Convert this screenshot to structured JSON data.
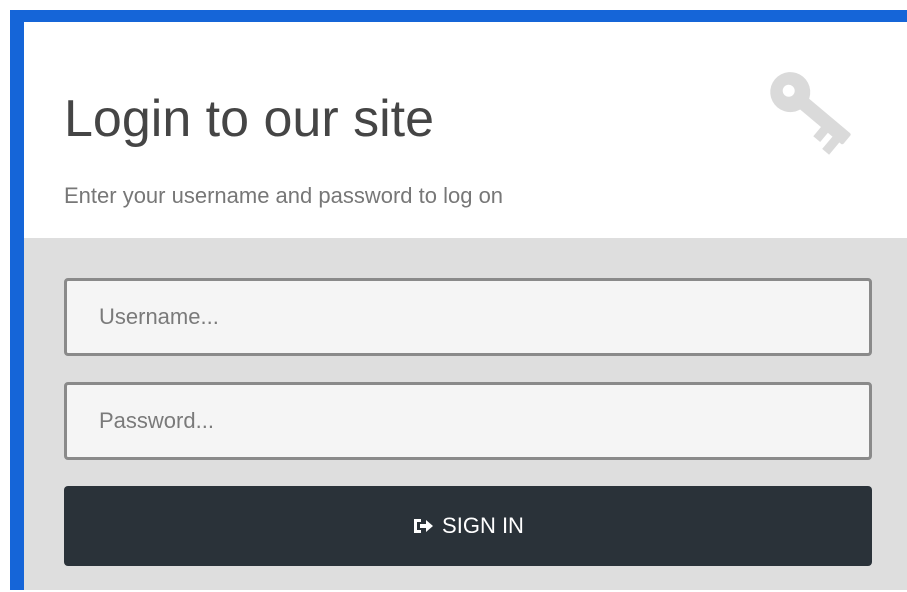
{
  "login": {
    "title": "Login to our site",
    "subtitle": "Enter your username and password to log on",
    "icon": "key-icon",
    "username_placeholder": "Username...",
    "password_placeholder": "Password...",
    "signin_label": "SIGN IN",
    "signin_icon": "sign-in-icon"
  },
  "colors": {
    "frame_accent": "#1565d8",
    "form_background": "#dedede",
    "button_background": "#2a3239",
    "button_text": "#ffffff"
  }
}
